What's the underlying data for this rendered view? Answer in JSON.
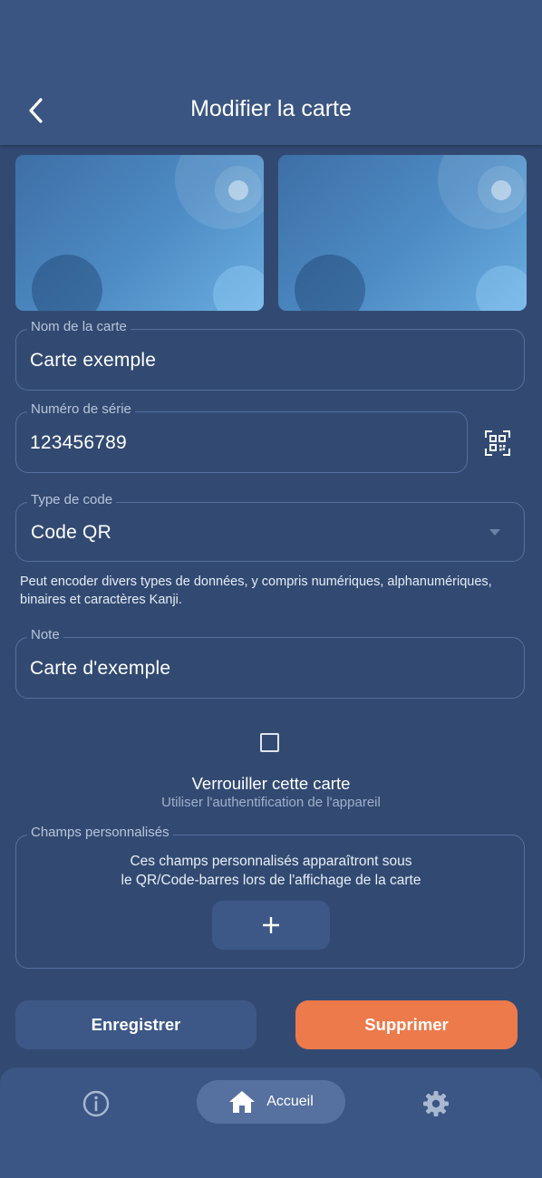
{
  "header": {
    "title": "Modifier la carte",
    "back_icon": "chevron-left-icon"
  },
  "card_images": {
    "front_label": "",
    "back_label": ""
  },
  "form": {
    "card_name": {
      "label": "Nom de la carte",
      "value": "Carte exemple"
    },
    "serial_number": {
      "label": "Numéro de série",
      "value": "123456789",
      "scan_icon": "qr-scan-icon"
    },
    "code_type": {
      "label": "Type de code",
      "value": "Code QR",
      "helper": "Peut encoder divers types de données, y compris numériques, alphanumériques, binaires et caractères Kanji."
    },
    "note": {
      "label": "Note",
      "value": "Carte d'exemple"
    }
  },
  "lock": {
    "checked": false,
    "title": "Verrouiller cette carte",
    "subtitle": "Utiliser l'authentification de l'appareil"
  },
  "custom_fields": {
    "label": "Champs personnalisés",
    "description_line1": "Ces champs personnalisés apparaîtront sous",
    "description_line2": "le QR/Code-barres lors de l'affichage de la carte",
    "add_icon": "plus-icon"
  },
  "actions": {
    "save_label": "Enregistrer",
    "delete_label": "Supprimer"
  },
  "bottom_nav": {
    "info_icon": "info-icon",
    "home_label": "Accueil",
    "home_icon": "home-icon",
    "settings_icon": "gear-icon"
  },
  "colors": {
    "background": "#324a72",
    "header": "#3a5581",
    "accent_delete": "#ec7a4b",
    "button_secondary": "#3d5887",
    "nav_active": "#5670a0"
  }
}
